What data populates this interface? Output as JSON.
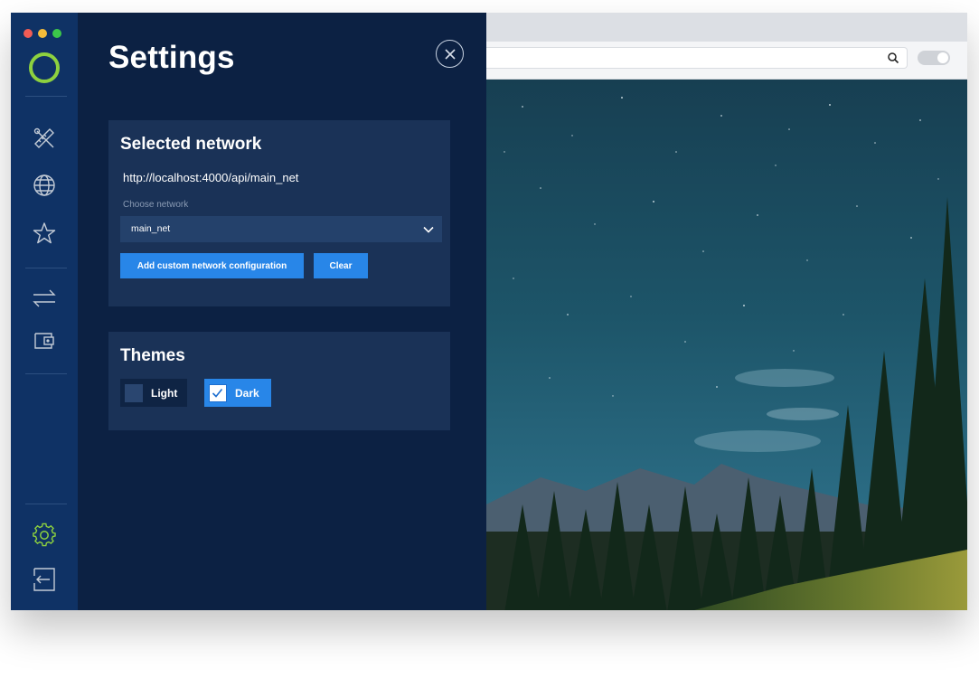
{
  "window": {
    "title": "Settings"
  },
  "rail": {
    "items": [
      {
        "name": "tools-icon"
      },
      {
        "name": "globe-icon"
      },
      {
        "name": "star-icon"
      },
      {
        "name": "transfer-icon"
      },
      {
        "name": "wallet-icon"
      },
      {
        "name": "gear-icon"
      },
      {
        "name": "logout-icon"
      }
    ],
    "accent": "#8dd13f"
  },
  "network": {
    "title": "Selected network",
    "url": "http://localhost:4000/api/main_net",
    "choose_label": "Choose network",
    "selected": "main_net",
    "add_button": "Add custom network configuration",
    "clear_button": "Clear"
  },
  "themes": {
    "title": "Themes",
    "options": [
      {
        "label": "Light",
        "checked": false
      },
      {
        "label": "Dark",
        "checked": true
      }
    ]
  },
  "colors": {
    "panel": "#0c2143",
    "card": "#1a3257",
    "button": "#2886e8"
  }
}
